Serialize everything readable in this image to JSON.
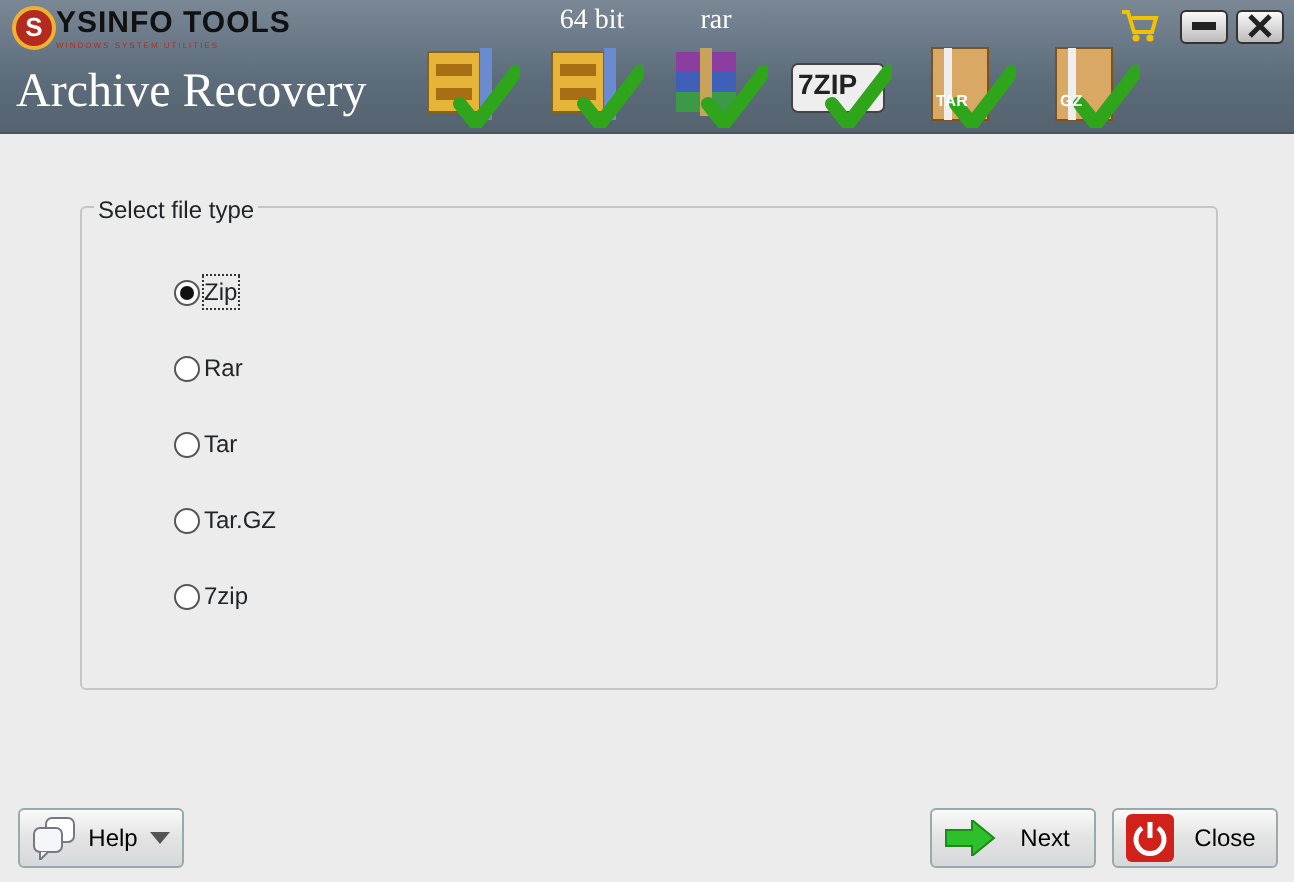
{
  "header": {
    "logo": {
      "initial": "S",
      "name": "YSINFO TOOLS",
      "tagline": "WINDOWS SYSTEM UTILITIES"
    },
    "title": "Archive Recovery",
    "formats": [
      {
        "kind": "zip"
      },
      {
        "kind": "zip",
        "caption": "64 bit"
      },
      {
        "kind": "rar",
        "caption": "rar"
      },
      {
        "kind": "box",
        "label": "7ZIP"
      },
      {
        "kind": "book",
        "label": "TAR"
      },
      {
        "kind": "book",
        "label": "GZ"
      }
    ]
  },
  "group": {
    "legend": "Select file type",
    "options": [
      {
        "label": "Zip",
        "selected": true
      },
      {
        "label": "Rar",
        "selected": false
      },
      {
        "label": "Tar",
        "selected": false
      },
      {
        "label": "Tar.GZ",
        "selected": false
      },
      {
        "label": "7zip",
        "selected": false
      }
    ]
  },
  "buttons": [
    {
      "kind": "help",
      "label": "Help"
    },
    {
      "kind": "next",
      "label": "Next"
    },
    {
      "kind": "close",
      "label": "Close"
    }
  ]
}
